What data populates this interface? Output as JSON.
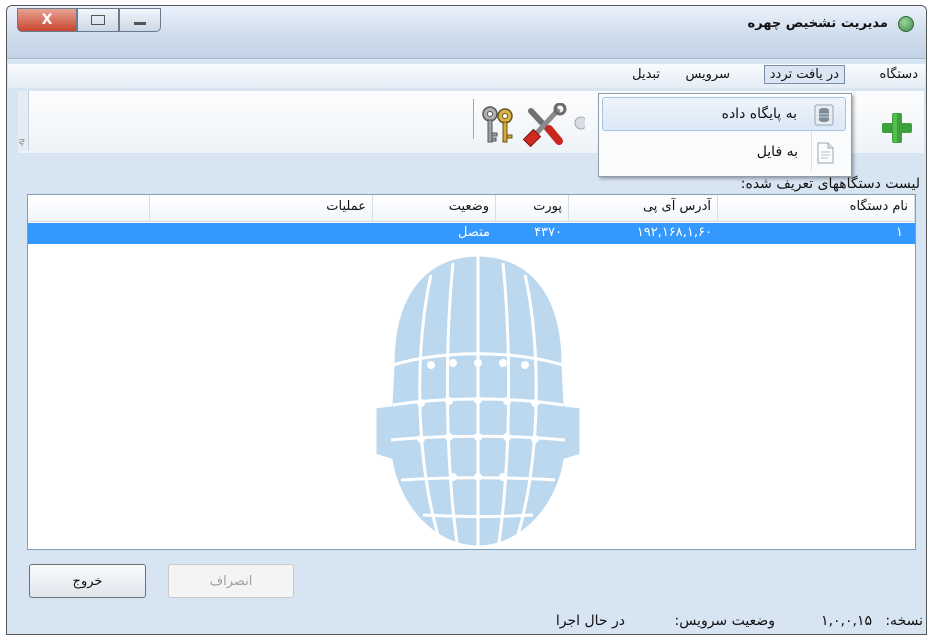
{
  "window": {
    "title": "مدیریت تشخیص چهره",
    "close_glyph": "X"
  },
  "menu": {
    "items": [
      {
        "label": "دستگاه"
      },
      {
        "label": "در یافت تردد"
      },
      {
        "label": "سرویس"
      },
      {
        "label": "تبدیل"
      }
    ],
    "dropdown": {
      "items": [
        {
          "label": "به پایگاه داده",
          "icon": "database-icon"
        },
        {
          "label": "به فایل",
          "icon": "file-icon"
        }
      ]
    }
  },
  "toolbar": {
    "grip_glyph": "ਵ",
    "icons": [
      "add-icon",
      "tools-icon",
      "keys-icon"
    ]
  },
  "list": {
    "title": "لیست دستگاههای تعریف شده:",
    "columns": [
      "نام دستگاه",
      "آدرس آی پی",
      "پورت",
      "وضعیت",
      "عملیات"
    ],
    "rows": [
      {
        "name": "۱",
        "ip": "۱۹۲,۱۶۸,۱,۶۰",
        "port": "۴۳۷۰",
        "status": "متصل",
        "ops": ""
      }
    ]
  },
  "buttons": {
    "exit": "خروج",
    "cancel": "انصراف"
  },
  "status": {
    "version_label": "نسخه:",
    "version_value": "۱,۰,۰,۱۵",
    "service_label": "وضعیت سرویس:",
    "service_value": "در حال اجرا"
  },
  "colors": {
    "selection": "#3399ff",
    "window_bg": "#d7e4f2",
    "plus_green": "#3ca03c"
  }
}
